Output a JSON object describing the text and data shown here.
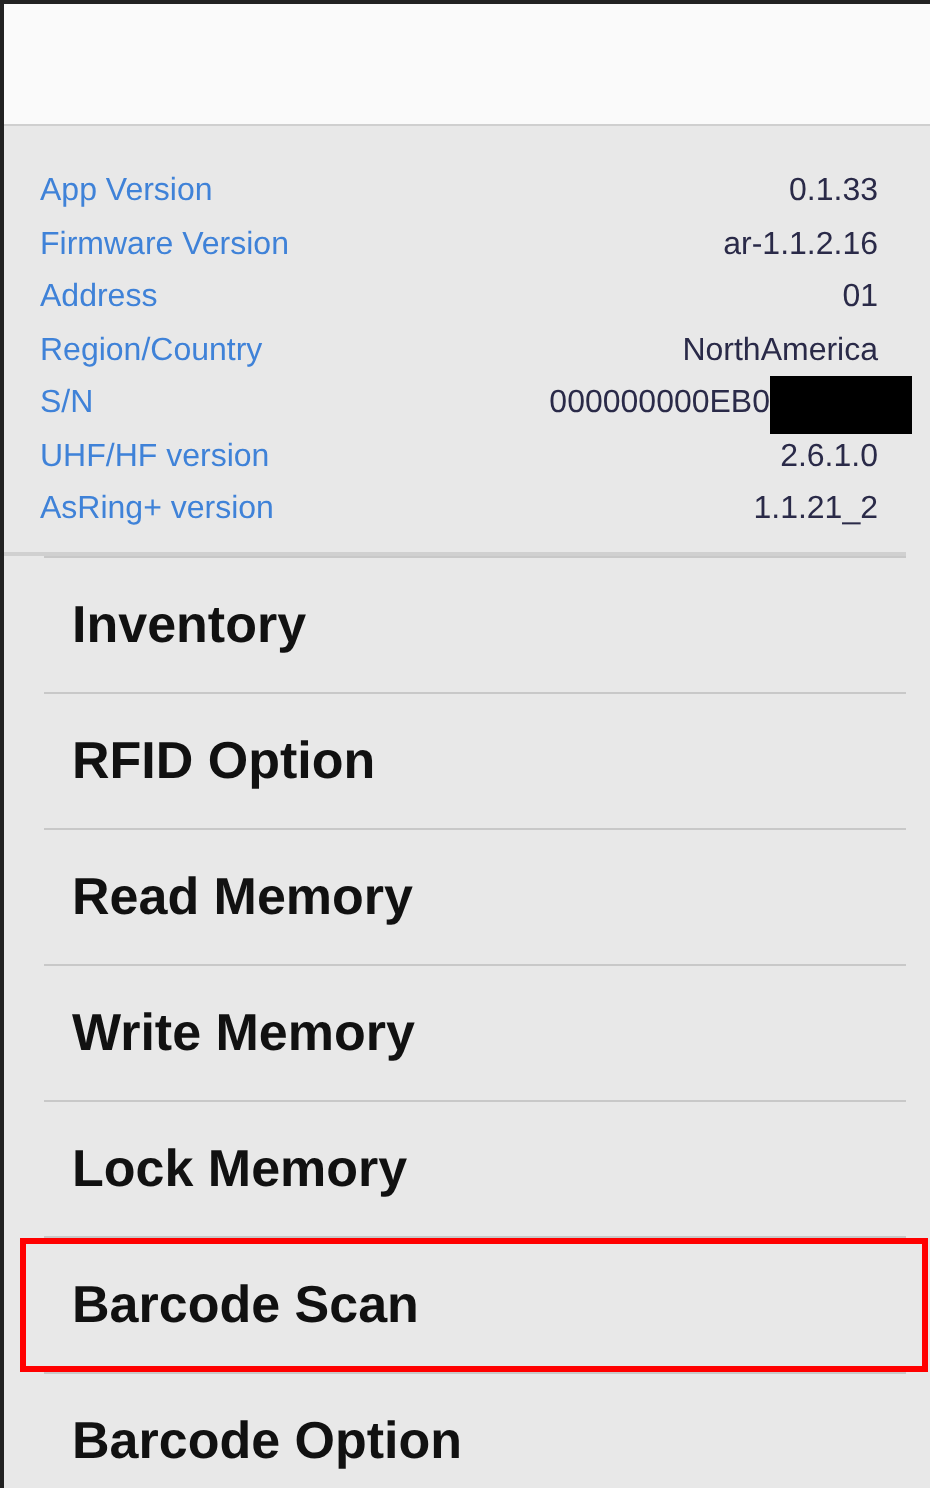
{
  "info_rows": [
    {
      "label": "App Version",
      "value": "0.1.33",
      "redacted": false
    },
    {
      "label": "Firmware Version",
      "value": "ar-1.1.2.16",
      "redacted": false
    },
    {
      "label": "Address",
      "value": "01",
      "redacted": false
    },
    {
      "label": "Region/Country",
      "value": "NorthAmerica",
      "redacted": false
    },
    {
      "label": "S/N",
      "value": "000000000EB0",
      "redacted": true
    },
    {
      "label": "UHF/HF version",
      "value": "2.6.1.0",
      "redacted": false
    },
    {
      "label": "AsRing+ version",
      "value": "1.1.21_2",
      "redacted": false
    }
  ],
  "menu_items": [
    {
      "label": "Inventory",
      "highlighted": false
    },
    {
      "label": "RFID Option",
      "highlighted": false
    },
    {
      "label": "Read Memory",
      "highlighted": false
    },
    {
      "label": "Write Memory",
      "highlighted": false
    },
    {
      "label": "Lock Memory",
      "highlighted": false
    },
    {
      "label": "Barcode Scan",
      "highlighted": true
    },
    {
      "label": "Barcode Option",
      "highlighted": false
    }
  ]
}
